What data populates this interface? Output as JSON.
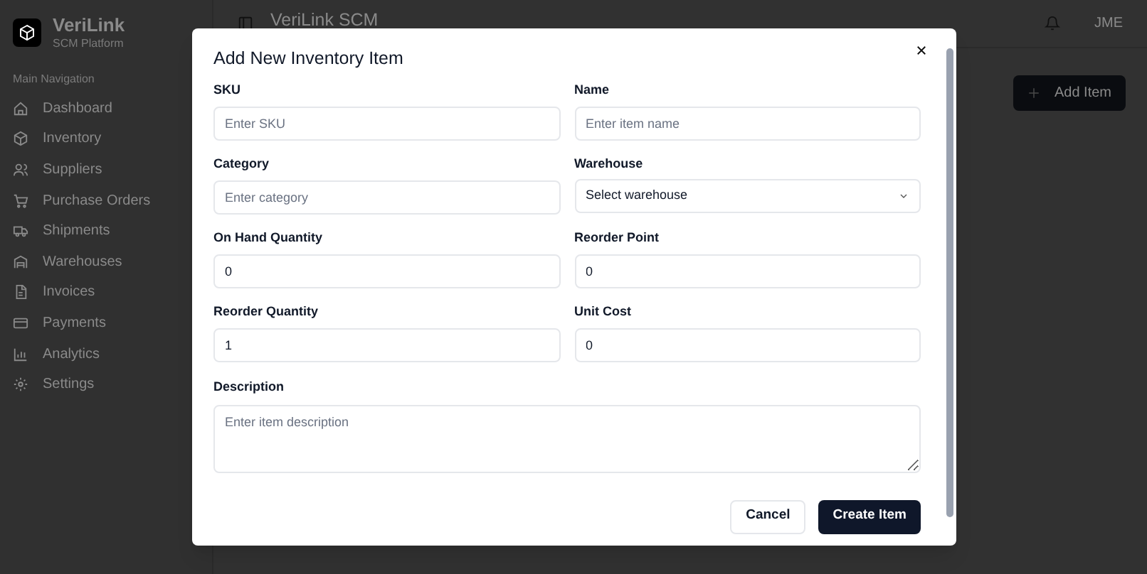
{
  "sidebar": {
    "brand": {
      "name": "VeriLink",
      "subtitle": "SCM Platform"
    },
    "section_label": "Main Navigation",
    "items": [
      {
        "label": "Dashboard"
      },
      {
        "label": "Inventory"
      },
      {
        "label": "Suppliers"
      },
      {
        "label": "Purchase Orders"
      },
      {
        "label": "Shipments"
      },
      {
        "label": "Warehouses"
      },
      {
        "label": "Invoices"
      },
      {
        "label": "Payments"
      },
      {
        "label": "Analytics"
      },
      {
        "label": "Settings"
      }
    ]
  },
  "header": {
    "title": "VeriLink SCM",
    "user": "JME"
  },
  "toolbar": {
    "add_button": "Add Item"
  },
  "dialog": {
    "title": "Add New Inventory Item",
    "fields": [
      {
        "label": "SKU",
        "kind": "input",
        "placeholder": "Enter SKU"
      },
      {
        "label": "Name",
        "kind": "input",
        "placeholder": "Enter item name"
      },
      {
        "label": "Category",
        "kind": "input",
        "placeholder": "Enter category"
      },
      {
        "label": "Warehouse",
        "kind": "select",
        "placeholder": "Select warehouse"
      },
      {
        "label": "On Hand Quantity",
        "kind": "input",
        "value": "0"
      },
      {
        "label": "Reorder Point",
        "kind": "input",
        "value": "0"
      },
      {
        "label": "Reorder Quantity",
        "kind": "input",
        "value": "1"
      },
      {
        "label": "Unit Cost",
        "kind": "input",
        "value": "0"
      }
    ],
    "description": {
      "label": "Description",
      "placeholder": "Enter item description"
    },
    "buttons": {
      "cancel": "Cancel",
      "submit": "Create Item"
    }
  }
}
